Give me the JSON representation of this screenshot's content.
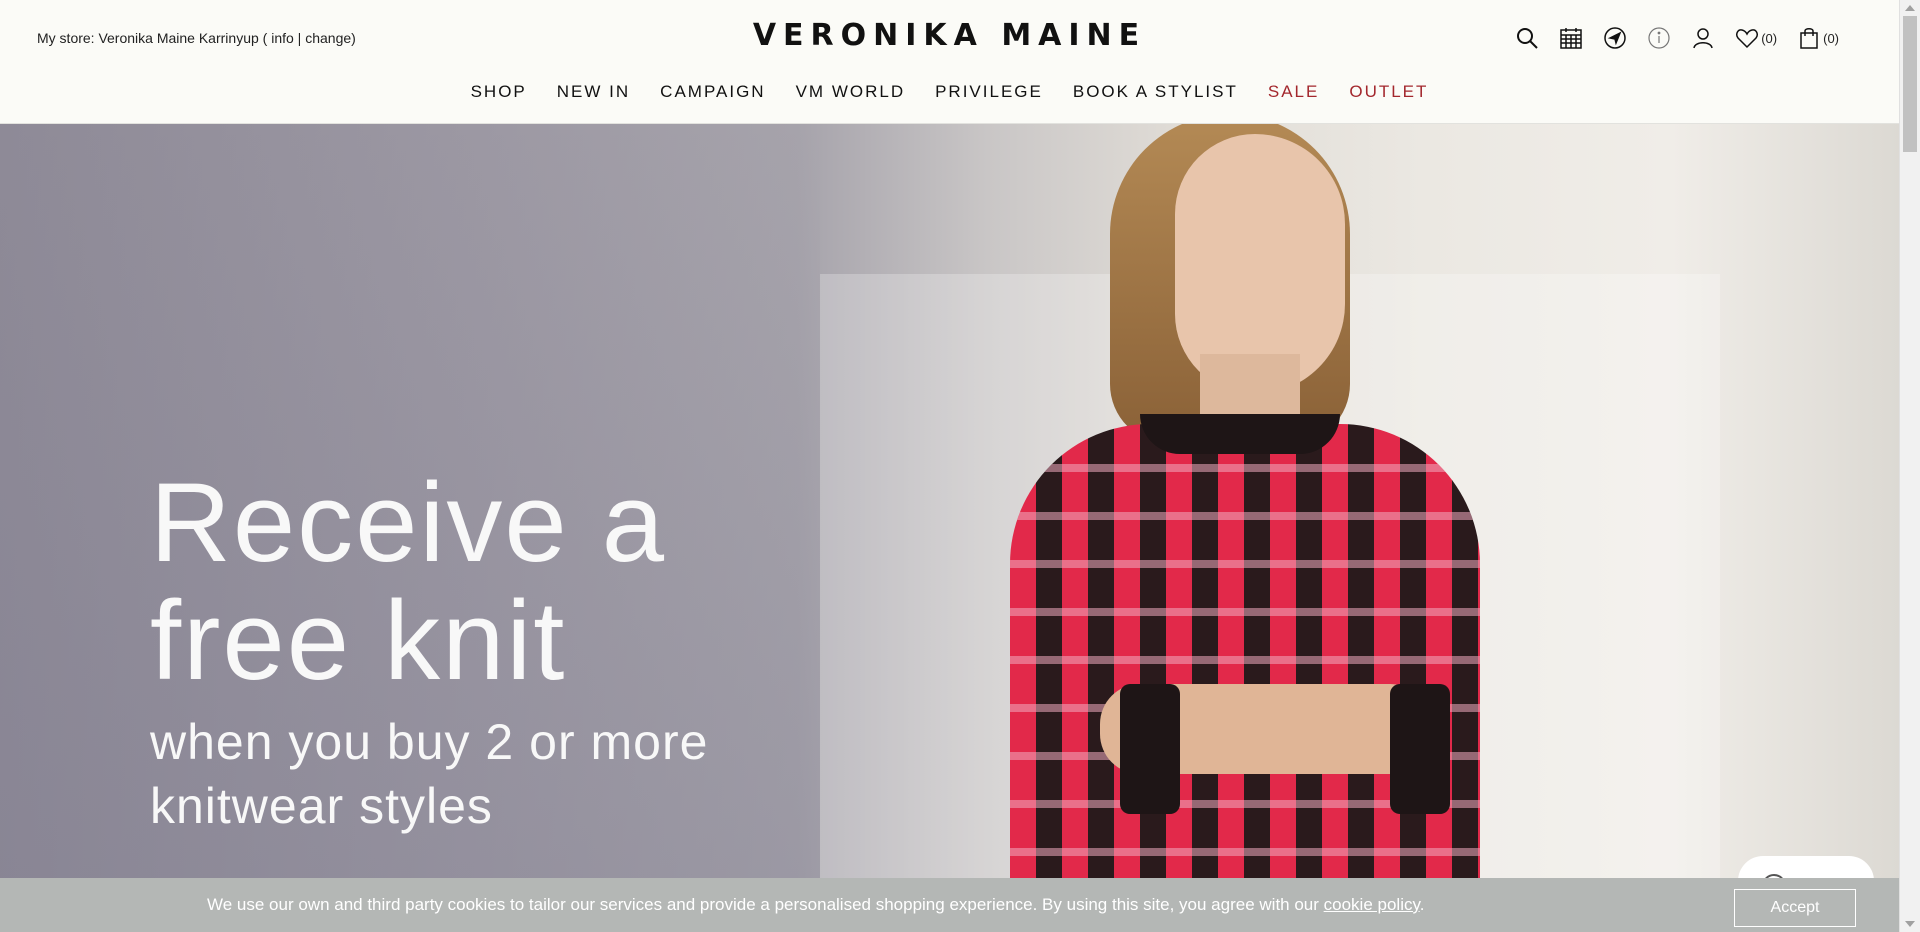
{
  "header": {
    "store_prefix": "My store: Veronika Maine Karrinyup (",
    "store_info": " info",
    "store_sep": " | ",
    "store_change": "change",
    "store_suffix": ")",
    "logo": "VERONIKA MAINE",
    "wishlist_count": "(0)",
    "cart_count": "(0)"
  },
  "nav": {
    "items": [
      {
        "label": "SHOP"
      },
      {
        "label": "NEW IN"
      },
      {
        "label": "CAMPAIGN"
      },
      {
        "label": "VM WORLD"
      },
      {
        "label": "PRIVILEGE"
      },
      {
        "label": "BOOK A STYLIST"
      },
      {
        "label": "SALE"
      },
      {
        "label": "OUTLET"
      }
    ]
  },
  "hero": {
    "line1": "Receive a",
    "line2": "free knit",
    "line3": "when you buy 2 or more",
    "line4": "knitwear styles"
  },
  "cookie": {
    "text": "We use our own and third party cookies to tailor our services and provide a personalised shopping experience. By using this site, you agree with our ",
    "link": "cookie policy",
    "end": ".",
    "accept": "Accept"
  },
  "icons": [
    "search-icon",
    "calendar-icon",
    "location-icon",
    "info-icon",
    "account-icon",
    "heart-icon",
    "bag-icon",
    "chat-icon"
  ],
  "colors": {
    "accent_red": "#a3272d",
    "cookie_bg": "#b4b7b5",
    "header_bg": "#fbfbf7"
  }
}
